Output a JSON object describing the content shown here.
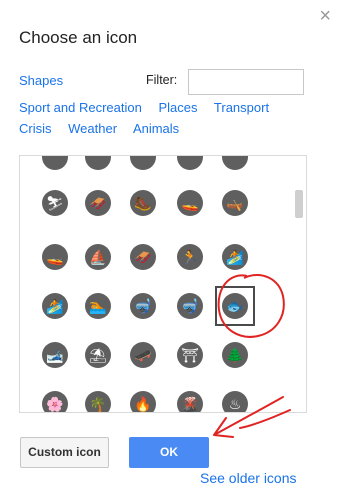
{
  "dialog": {
    "close_glyph": "×",
    "title": "Choose an icon"
  },
  "filter": {
    "shapes_link": "Shapes",
    "label": "Filter:",
    "value": "",
    "placeholder": ""
  },
  "categories": {
    "row1": [
      "Sport and Recreation",
      "Places",
      "Transport"
    ],
    "row2": [
      "Crisis",
      "Weather",
      "Animals"
    ]
  },
  "icon_grid": {
    "columns": 5,
    "rows": [
      [
        "",
        "",
        "",
        "",
        ""
      ],
      [
        "cross-country-skiing-icon",
        "luge-icon",
        "hiking-icon",
        "jet-ski-icon",
        "kayaking-icon"
      ],
      [
        "motorboat-icon",
        "sailing-icon",
        "snowmobile-icon",
        "running-icon",
        "waterskiing-icon"
      ],
      [
        "windsurfing-icon",
        "swimming-icon",
        "snorkeling-icon",
        "scuba-diving-icon",
        "fishing-icon"
      ],
      [
        "ski-jumping-icon",
        "beach-umbrella-icon",
        "skateboarding-icon",
        "picnic-table-icon",
        "tree-icon"
      ],
      [
        "flower-icon",
        "palm-tree-icon",
        "campfire-icon",
        "volcano-icon",
        "hot-springs-icon"
      ]
    ],
    "glyphs": [
      [
        "",
        "",
        "",
        "",
        ""
      ],
      [
        "⛷",
        "🛷",
        "🥾",
        "🚤",
        "🛶"
      ],
      [
        "🚤",
        "⛵",
        "🛷",
        "🏃",
        "🏄"
      ],
      [
        "🏄",
        "🏊",
        "🤿",
        "🤿",
        "🐟"
      ],
      [
        "🎿",
        "⛱",
        "🛹",
        "⛩",
        "🌲"
      ],
      [
        "🌸",
        "🌴",
        "🔥",
        "🌋",
        "♨"
      ]
    ],
    "selected": "fishing-icon"
  },
  "footer": {
    "custom_icon_label": "Custom icon",
    "ok_label": "OK",
    "older_icons_link": "See older icons"
  },
  "colors": {
    "link": "#1a73e8",
    "ok_button": "#4a8af4",
    "icon_bg": "#5f5f5f",
    "annotation_red": "#e02424"
  }
}
